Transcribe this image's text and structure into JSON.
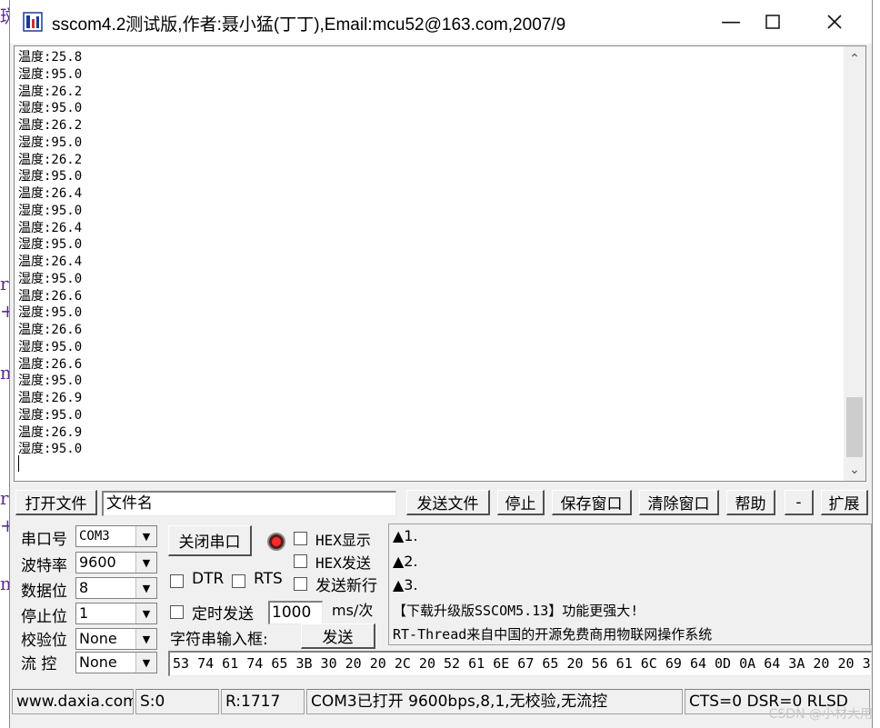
{
  "window": {
    "title": "sscom4.2测试版,作者:聂小猛(丁丁),Email:mcu52@163.com,2007/9"
  },
  "receive": {
    "lines": [
      "温度:25.8",
      "湿度:95.0",
      "温度:26.2",
      "湿度:95.0",
      "温度:26.2",
      "湿度:95.0",
      "温度:26.2",
      "湿度:95.0",
      "温度:26.4",
      "湿度:95.0",
      "温度:26.4",
      "湿度:95.0",
      "温度:26.4",
      "湿度:95.0",
      "温度:26.6",
      "湿度:95.0",
      "温度:26.6",
      "湿度:95.0",
      "温度:26.6",
      "湿度:95.0",
      "温度:26.9",
      "湿度:95.0",
      "温度:26.9",
      "湿度:95.0"
    ]
  },
  "toolbar": {
    "open_file": "打开文件",
    "file_name": "文件名",
    "send_file": "发送文件",
    "stop": "停止",
    "save_window": "保存窗口",
    "clear_window": "清除窗口",
    "help": "帮助",
    "minus": "-",
    "expand": "扩展"
  },
  "serial": {
    "port_label": "串口号",
    "port_value": "COM3",
    "baud_label": "波特率",
    "baud_value": "9600",
    "databits_label": "数据位",
    "databits_value": "8",
    "stopbits_label": "停止位",
    "stopbits_value": "1",
    "parity_label": "校验位",
    "parity_value": "None",
    "flow_label": "流 控",
    "flow_value": "None"
  },
  "controls": {
    "close_port": "关闭串口",
    "hex_display": "HEX显示",
    "hex_send": "HEX发送",
    "dtr": "DTR",
    "rts": "RTS",
    "send_newline": "发送新行",
    "timed_send": "定时发送",
    "interval_value": "1000",
    "interval_unit": "ms/次",
    "input_label": "字符串输入框:",
    "send": "发送",
    "send_data": "53 74 61 74 65 3B 30 20 20 2C 20 52 61 6E 67 65 20 56 61 6C 69 64 0D 0A 64 3A 20 20 3"
  },
  "info": {
    "line1": "▲1.",
    "line2": "▲2.",
    "line3": "▲3.",
    "line4": "【下载升级版SSCOM5.13】功能更强大!",
    "line5": "RT-Thread来自中国的开源免费商用物联网操作系统"
  },
  "status": {
    "site": "www.daxia.com",
    "sent": "S:0",
    "received": "R:1717",
    "port_state": "COM3已打开  9600bps,8,1,无校验,无流控",
    "signals": "CTS=0 DSR=0 RLSD"
  },
  "watermark": "CSDN @小材大用"
}
